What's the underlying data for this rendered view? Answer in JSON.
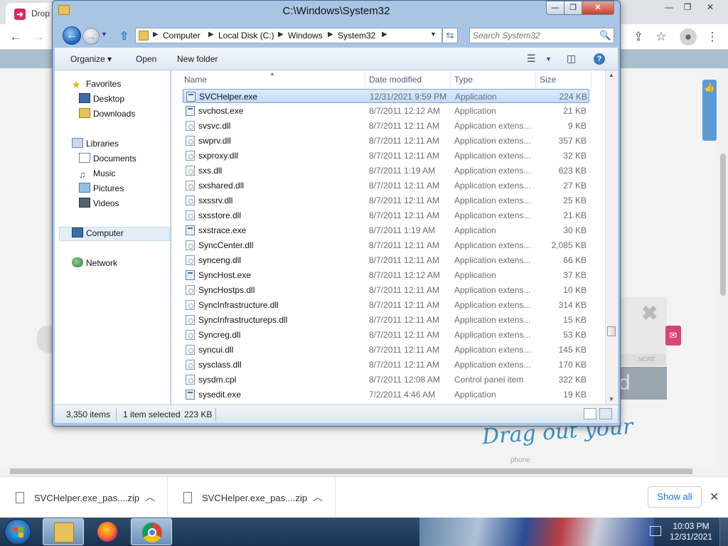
{
  "browser": {
    "tab_title": "Drop",
    "tab_title_faded": "...",
    "favicon_glyph": "➜",
    "win_controls": [
      "—",
      "❐",
      "✕"
    ],
    "toolbar_icons": [
      "back-arrow",
      "forward-arrow",
      "share",
      "star",
      "profile",
      "menu"
    ]
  },
  "page": {
    "drag_text": "Drag out your",
    "drag_sub": "phone",
    "ad_more": "MORE",
    "ad_panel_text": "d"
  },
  "explorer": {
    "title": "C:\\Windows\\System32",
    "controls": {
      "minimize": "—",
      "maximize": "❐",
      "close": "✕"
    },
    "breadcrumb": [
      "Computer",
      "Local Disk (C:)",
      "Windows",
      "System32"
    ],
    "search_placeholder": "Search System32",
    "commands": {
      "organize": "Organize ▾",
      "open": "Open",
      "new_folder": "New folder"
    },
    "nav": {
      "favorites_header": "Favorites",
      "favorites": [
        "Desktop",
        "Downloads"
      ],
      "libraries_header": "Libraries",
      "libraries": [
        "Documents",
        "Music",
        "Pictures",
        "Videos"
      ],
      "computer": "Computer",
      "network": "Network"
    },
    "columns": {
      "name": "Name",
      "date": "Date modified",
      "type": "Type",
      "size": "Size"
    },
    "files": [
      {
        "name": "SVCHelper.exe",
        "date": "12/31/2021 9:59 PM",
        "type": "Application",
        "size": "224 KB",
        "kind": "app",
        "selected": true
      },
      {
        "name": "svchost.exe",
        "date": "8/7/2011 12:12 AM",
        "type": "Application",
        "size": "21 KB",
        "kind": "app"
      },
      {
        "name": "svsvc.dll",
        "date": "8/7/2011 12:11 AM",
        "type": "Application extens...",
        "size": "9 KB",
        "kind": "dll"
      },
      {
        "name": "swprv.dll",
        "date": "8/7/2011 12:11 AM",
        "type": "Application extens...",
        "size": "357 KB",
        "kind": "dll"
      },
      {
        "name": "sxproxy.dll",
        "date": "8/7/2011 12:11 AM",
        "type": "Application extens...",
        "size": "32 KB",
        "kind": "dll"
      },
      {
        "name": "sxs.dll",
        "date": "8/7/2011 1:19 AM",
        "type": "Application extens...",
        "size": "623 KB",
        "kind": "dll"
      },
      {
        "name": "sxshared.dll",
        "date": "8/7/2011 12:11 AM",
        "type": "Application extens...",
        "size": "27 KB",
        "kind": "dll"
      },
      {
        "name": "sxssrv.dll",
        "date": "8/7/2011 12:11 AM",
        "type": "Application extens...",
        "size": "25 KB",
        "kind": "dll"
      },
      {
        "name": "sxsstore.dll",
        "date": "8/7/2011 12:11 AM",
        "type": "Application extens...",
        "size": "21 KB",
        "kind": "dll"
      },
      {
        "name": "sxstrace.exe",
        "date": "8/7/2011 1:19 AM",
        "type": "Application",
        "size": "30 KB",
        "kind": "app"
      },
      {
        "name": "SyncCenter.dll",
        "date": "8/7/2011 12:11 AM",
        "type": "Application extens...",
        "size": "2,085 KB",
        "kind": "dll"
      },
      {
        "name": "synceng.dll",
        "date": "8/7/2011 12:11 AM",
        "type": "Application extens...",
        "size": "66 KB",
        "kind": "dll"
      },
      {
        "name": "SyncHost.exe",
        "date": "8/7/2011 12:12 AM",
        "type": "Application",
        "size": "37 KB",
        "kind": "app"
      },
      {
        "name": "SyncHostps.dll",
        "date": "8/7/2011 12:11 AM",
        "type": "Application extens...",
        "size": "10 KB",
        "kind": "dll"
      },
      {
        "name": "SyncInfrastructure.dll",
        "date": "8/7/2011 12:11 AM",
        "type": "Application extens...",
        "size": "314 KB",
        "kind": "dll"
      },
      {
        "name": "SyncInfrastructureps.dll",
        "date": "8/7/2011 12:11 AM",
        "type": "Application extens...",
        "size": "15 KB",
        "kind": "dll"
      },
      {
        "name": "Syncreg.dll",
        "date": "8/7/2011 12:11 AM",
        "type": "Application extens...",
        "size": "53 KB",
        "kind": "dll"
      },
      {
        "name": "syncui.dll",
        "date": "8/7/2011 12:11 AM",
        "type": "Application extens...",
        "size": "145 KB",
        "kind": "dll"
      },
      {
        "name": "sysclass.dll",
        "date": "8/7/2011 12:11 AM",
        "type": "Application extens...",
        "size": "170 KB",
        "kind": "dll"
      },
      {
        "name": "sysdm.cpl",
        "date": "8/7/2011 12:08 AM",
        "type": "Control panel item",
        "size": "322 KB",
        "kind": "dll"
      },
      {
        "name": "sysedit.exe",
        "date": "7/2/2011 4:46 AM",
        "type": "Application",
        "size": "19 KB",
        "kind": "app"
      }
    ],
    "status": {
      "item_count": "3,350 items",
      "selection": "1 item selected",
      "selection_size": "223 KB"
    }
  },
  "downloads": {
    "items": [
      "SVCHelper.exe_pas....zip",
      "SVCHelper.exe_pas....zip"
    ],
    "show_all": "Show all",
    "close": "✕"
  },
  "taskbar": {
    "time": "10:03 PM",
    "date": "12/31/2021"
  }
}
